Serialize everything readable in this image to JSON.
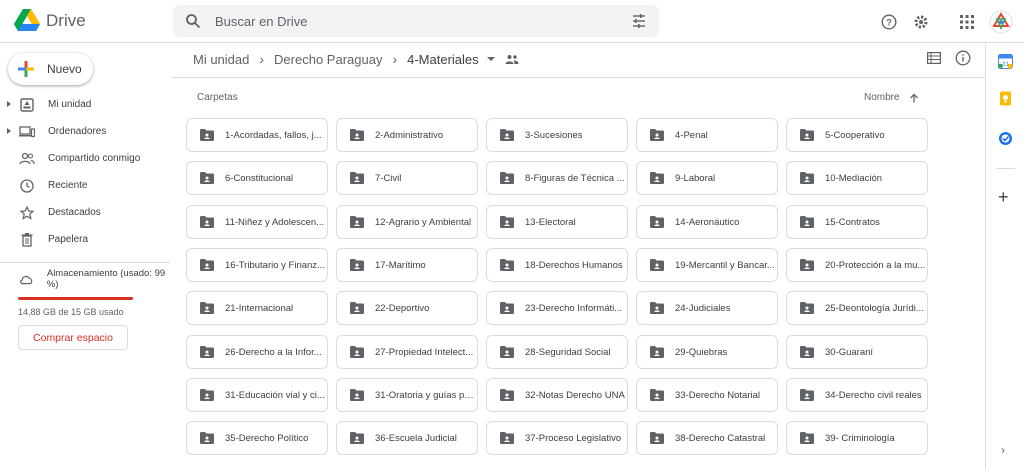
{
  "app": {
    "title": "Drive"
  },
  "search": {
    "placeholder": "Buscar en Drive"
  },
  "header_icons": [
    "help-icon",
    "settings-icon",
    "apps-grid-icon",
    "account-avatar"
  ],
  "sidebar": {
    "new_label": "Nuevo",
    "items": [
      {
        "label": "Mi unidad",
        "icon": "my-drive-icon",
        "expandable": true
      },
      {
        "label": "Ordenadores",
        "icon": "computers-icon",
        "expandable": true
      },
      {
        "label": "Compartido conmigo",
        "icon": "shared-icon",
        "expandable": false
      },
      {
        "label": "Reciente",
        "icon": "clock-icon",
        "expandable": false
      },
      {
        "label": "Destacados",
        "icon": "star-icon",
        "expandable": false
      },
      {
        "label": "Papelera",
        "icon": "trash-icon",
        "expandable": false
      }
    ],
    "storage": {
      "label": "Almacenamiento (usado: 99 %)",
      "used_text": "14,88 GB de 15 GB usado",
      "used_fraction": 0.99,
      "bar_color": "#d93025",
      "buy_label": "Comprar espacio"
    }
  },
  "breadcrumb": {
    "items": [
      "Mi unidad",
      "Derecho Paraguay",
      "4-Materiales"
    ]
  },
  "list": {
    "section_label": "Carpetas",
    "sort_label": "Nombre",
    "folders": [
      "1-Acordadas, fallos, j...",
      "2-Administrativo",
      "3-Sucesiones",
      "4-Penal",
      "5-Cooperativo",
      "6-Constitucional",
      "7-Civil",
      "8-Figuras de Técnica ...",
      "9-Laboral",
      "10-Mediación",
      "11-Niñez y Adolescen...",
      "12-Agrario y Ambiental",
      "13-Electoral",
      "14-Aeronáutico",
      "15-Contratos",
      "16-Tributario y Finanz...",
      "17-Marítimo",
      "18-Derechos Humanos",
      "19-Mercantil y Bancar...",
      "20-Protección a la mu...",
      "21-Internacional",
      "22-Deportivo",
      "23-Derecho Informáti...",
      "24-Judiciales",
      "25-Deontología Jurídi...",
      "26-Derecho a la Infor...",
      "27-Propiedad Intelect...",
      "28-Seguridad Social",
      "29-Quiebras",
      "30-Guaraní",
      "31-Educación vial y ci...",
      "31-Oratoria y guías pa...",
      "32-Notas Derecho UNA",
      "33-Derecho Notarial",
      "34-Derecho civil reales",
      "35-Derecho Político",
      "36-Escuela Judicial",
      "37-Proceso Legislativo",
      "38-Derecho Catastral",
      "39- Criminología"
    ]
  },
  "right_panel": [
    "calendar-icon",
    "keep-icon",
    "tasks-icon",
    "add-icon",
    "expand-icon"
  ]
}
